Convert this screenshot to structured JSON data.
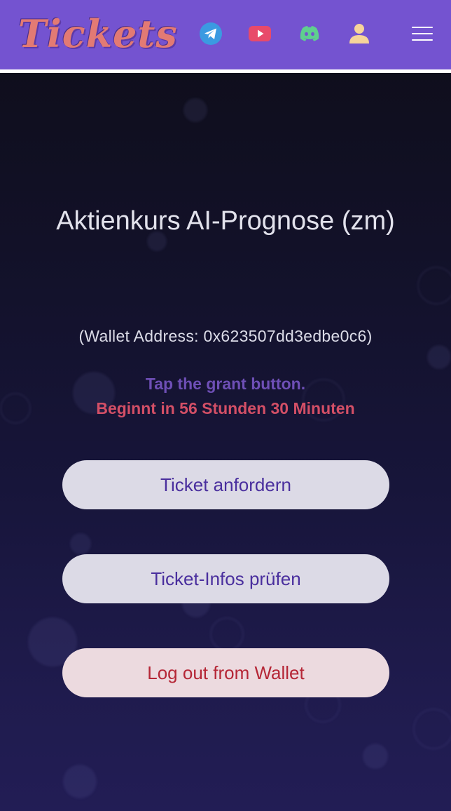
{
  "header": {
    "logo_text": "Tickets",
    "icons": [
      "telegram-icon",
      "youtube-icon",
      "discord-icon",
      "user-icon",
      "menu-icon"
    ],
    "colors": {
      "header_bg": "#7453d0",
      "logo": "#e27a74",
      "user_icon": "#f6d49a"
    }
  },
  "main": {
    "title": "Aktienkurs AI-Prognose (zm)",
    "wallet_text": "(Wallet Address: 0x623507dd3edbe0c6)",
    "hint_text": "Tap the grant button.",
    "countdown_text": "Beginnt in 56 Stunden 30 Minuten"
  },
  "buttons": {
    "request_ticket": "Ticket anfordern",
    "check_ticket": "Ticket-Infos prüfen",
    "logout": "Log out from Wallet"
  }
}
